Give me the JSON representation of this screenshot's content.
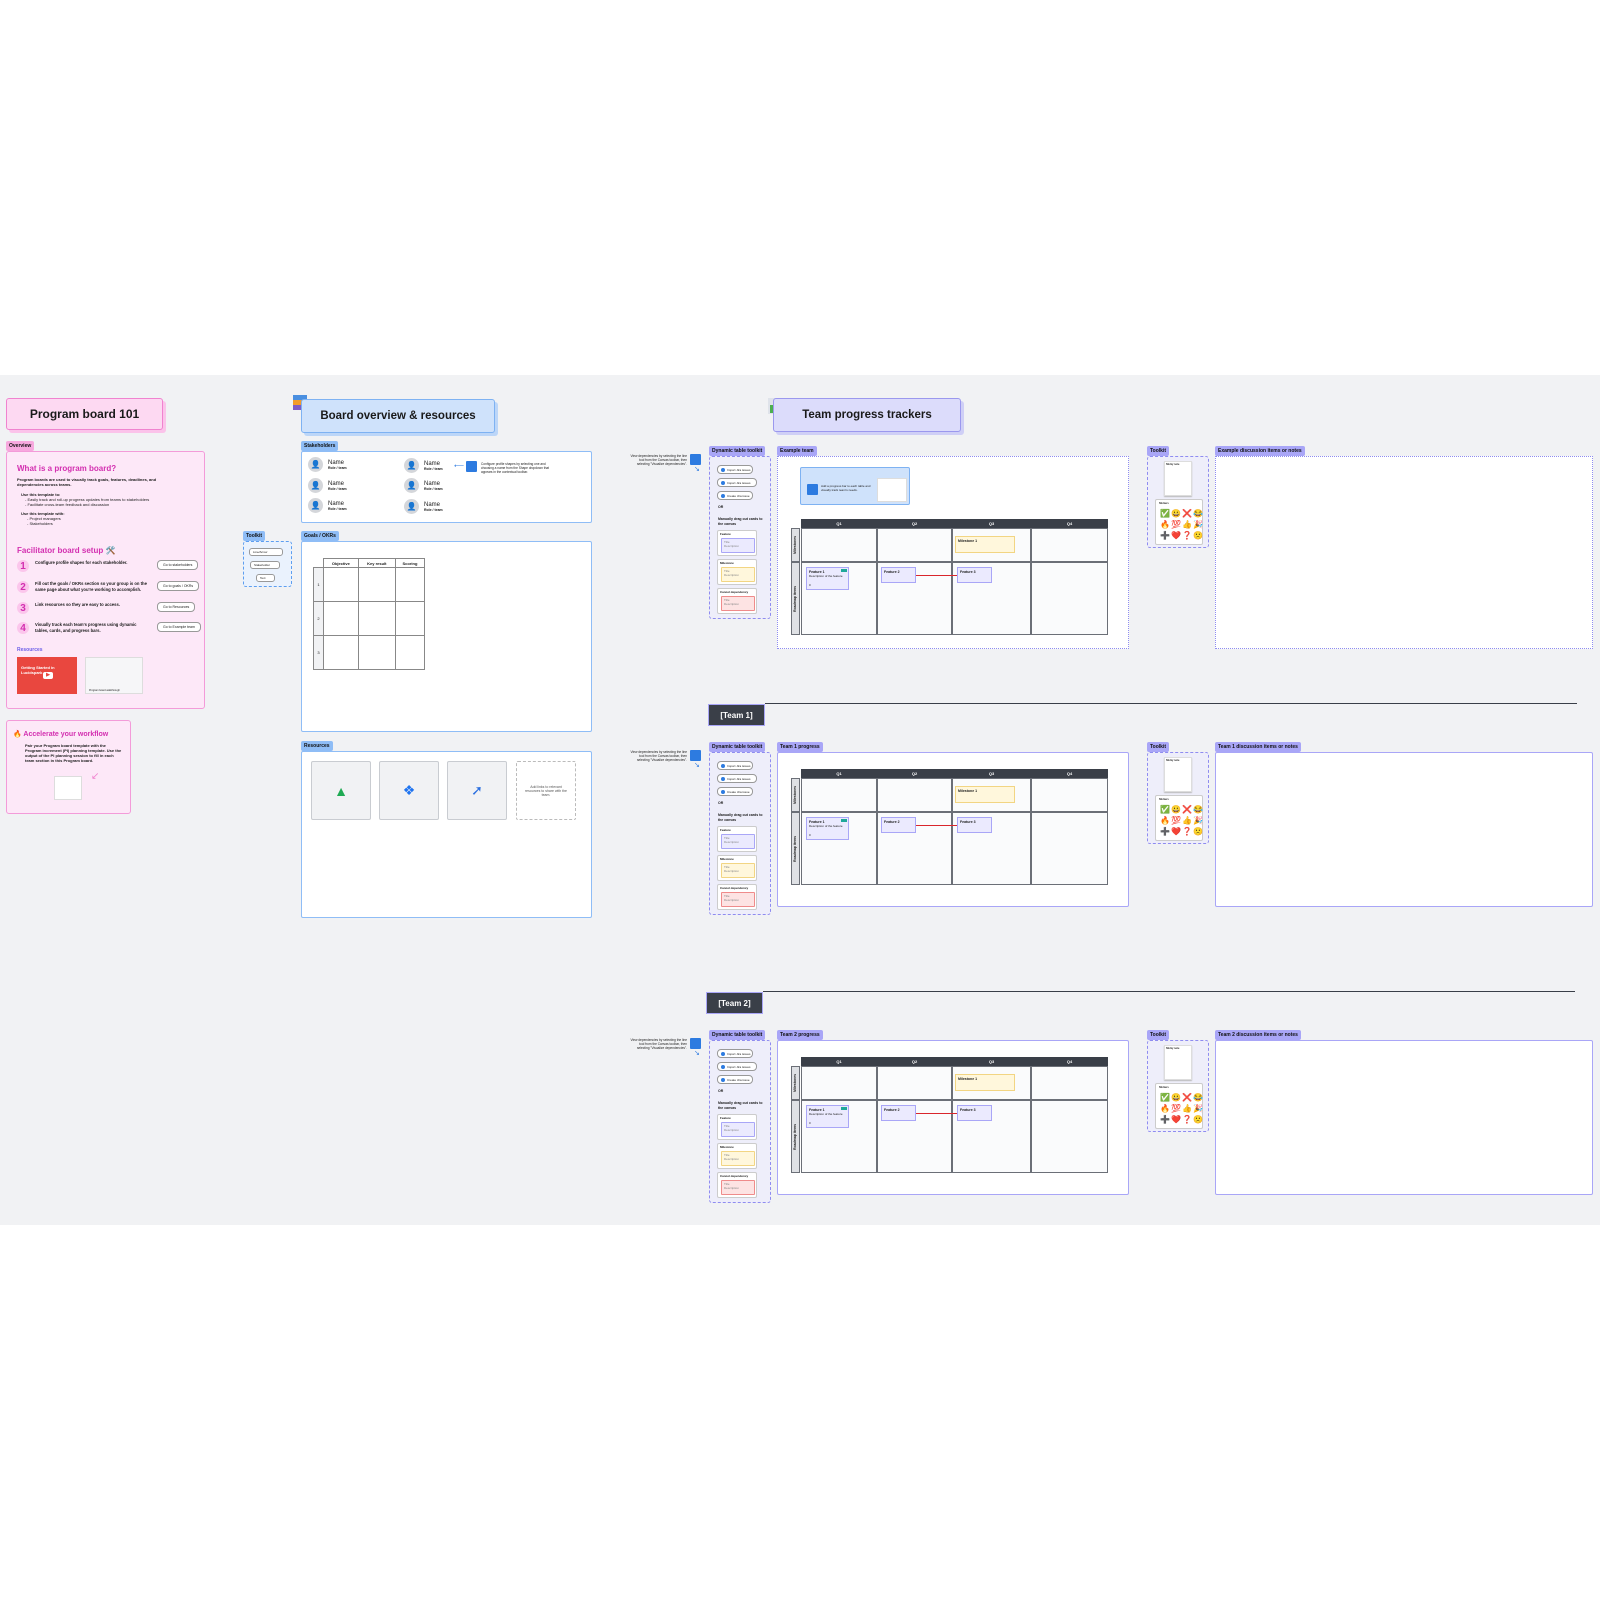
{
  "program_board": {
    "title": "Program board 101",
    "overview_tag": "Overview",
    "what_heading": "What is a program board?",
    "what_body": "Program boards are used to visually track goals, features, deadlines, and dependencies across teams.",
    "use_to_heading": "Use this template to:",
    "use_to_items": [
      "- Easily track and roll-up progress updates from teams to stakeholders",
      "- Facilitate cross-team feedback and discussion"
    ],
    "use_with_heading": "Use this template with:",
    "use_with_items": [
      "- Project managers",
      "- Stakeholders"
    ],
    "setup_heading": "Facilitator board setup 🛠️",
    "steps": [
      {
        "num": "1",
        "text": "Configure profile shapes for each stakeholder.",
        "button": "Go to stakeholders"
      },
      {
        "num": "2",
        "text": "Fill out the goals / OKRs section so your group is on the same page about what you're working to accomplish.",
        "button": "Go to goals / OKRs"
      },
      {
        "num": "3",
        "text": "Link resources so they are easy to access.",
        "button": "Go to Resources"
      },
      {
        "num": "4",
        "text": "Visually track each team's progress using dynamic tables, cards, and progress bars.",
        "button": "Go to Example team"
      }
    ],
    "resources_heading": "Resources",
    "resource_videos": [
      "Getting Started in Lucidspark",
      "Program board walkthrough"
    ],
    "accelerate_heading": "Accelerate your workflow",
    "accelerate_body": "Pair your Program board template with the Program increment (PI) planning template. Use the output of the PI planning session to fill in each team section in this Program board."
  },
  "board_overview": {
    "title": "Board overview & resources",
    "stakeholders_tag": "Stakeholders",
    "stakeholders": [
      {
        "name": "Name",
        "role": "Role / team"
      },
      {
        "name": "Name",
        "role": "Role / team"
      },
      {
        "name": "Name",
        "role": "Role / team"
      },
      {
        "name": "Name",
        "role": "Role / team"
      },
      {
        "name": "Name",
        "role": "Role / team"
      },
      {
        "name": "Name",
        "role": "Role / team"
      }
    ],
    "stakeholder_note": "Configure profile shapes by selecting one and choosing a name from the Shape dropdown that appears in the contextual toolbar.",
    "toolkit_tag": "Toolkit",
    "toolkit_items": [
      "Line/Arrow",
      "Stakeholder",
      "Text"
    ],
    "goals_tag": "Goals / OKRs",
    "okr_columns": [
      "Objective",
      "Key result",
      "Scoring"
    ],
    "okr_rows": [
      "1",
      "2",
      "3"
    ],
    "resources_tag": "Resources",
    "resource_links": [
      {
        "icon": "google-drive-icon",
        "glyph": "▲"
      },
      {
        "icon": "dropbox-icon",
        "glyph": "❖"
      },
      {
        "icon": "jira-icon",
        "glyph": "➚"
      }
    ],
    "resource_placeholder": "Add links to relevant resources to share with the team."
  },
  "team_trackers": {
    "title": "Team progress trackers",
    "dependency_note": "View dependencies by selecting the line tool from the Canvas toolbar, then selecting \"Visualize dependencies\".",
    "dynamic_toolkit_tag": "Dynamic table toolkit",
    "dynamic_buttons": [
      "Import Jira issues",
      "Import Jira issues",
      "Create Jira issue"
    ],
    "or_label": "OR",
    "drag_label": "Manually drag out cards to the canvas",
    "templates": [
      {
        "label": "Feature",
        "title": "Title",
        "desc": "Description",
        "color": "#ebeafe",
        "border": "#a9a6f7"
      },
      {
        "label": "Milestone",
        "title": "Title",
        "desc": "Description",
        "color": "#fff7dc",
        "border": "#f2d583"
      },
      {
        "label": "Cancel dependency",
        "title": "Title",
        "desc": "Description",
        "color": "#fde3e3",
        "border": "#ef8b8b"
      }
    ],
    "quarters": [
      "Q1",
      "Q2",
      "Q3",
      "Q4"
    ],
    "row_labels": [
      "Milestones",
      "Roadmap items"
    ],
    "milestone_label": "Milestone 1",
    "features": [
      {
        "title": "Feature 1",
        "desc": "Description of the feature",
        "count": "0"
      },
      {
        "title": "Feature 2"
      },
      {
        "title": "Feature 3"
      }
    ],
    "help_banner": "Add a progress bar to each table and visually track team's needs.",
    "toolkit_tag": "Toolkit",
    "sticky_label": "Sticky note",
    "stickers_label": "Stickers",
    "stickers": [
      "✅",
      "😀",
      "❌",
      "😂",
      "🔥",
      "💯",
      "👍",
      "🎉",
      "➕",
      "❤️",
      "❓",
      "🙁"
    ],
    "sections": [
      {
        "team_header": "",
        "progress_tag": "Example team",
        "notes_tag": "Example discussion items or notes"
      },
      {
        "team_header": "[Team 1]",
        "progress_tag": "Team 1 progress",
        "notes_tag": "Team 1 discussion items or notes"
      },
      {
        "team_header": "[Team 2]",
        "progress_tag": "Team 2 progress",
        "notes_tag": "Team 2 discussion items or notes"
      }
    ]
  }
}
